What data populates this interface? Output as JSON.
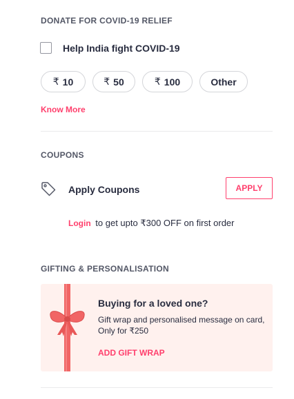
{
  "donate": {
    "title": "DONATE FOR COVID-19 RELIEF",
    "checkbox_label": "Help India fight COVID-19",
    "currency_symbol": "₹",
    "amounts": [
      "10",
      "50",
      "100"
    ],
    "other_label": "Other",
    "know_more": "Know More"
  },
  "coupons": {
    "title": "COUPONS",
    "icon": "tag-icon",
    "label": "Apply Coupons",
    "apply_button": "APPLY",
    "login_link": "Login",
    "login_text": "to get upto ₹300 OFF on first order"
  },
  "gifting": {
    "title": "GIFTING & PERSONALISATION",
    "heading": "Buying for a loved one?",
    "description_line1": "Gift wrap and personalised message on card,",
    "description_line2": "Only for ₹250",
    "action": "ADD GIFT WRAP"
  },
  "colors": {
    "accent": "#ff3f6c",
    "gift_bg": "#fff1ee",
    "ribbon": "#f16565"
  }
}
